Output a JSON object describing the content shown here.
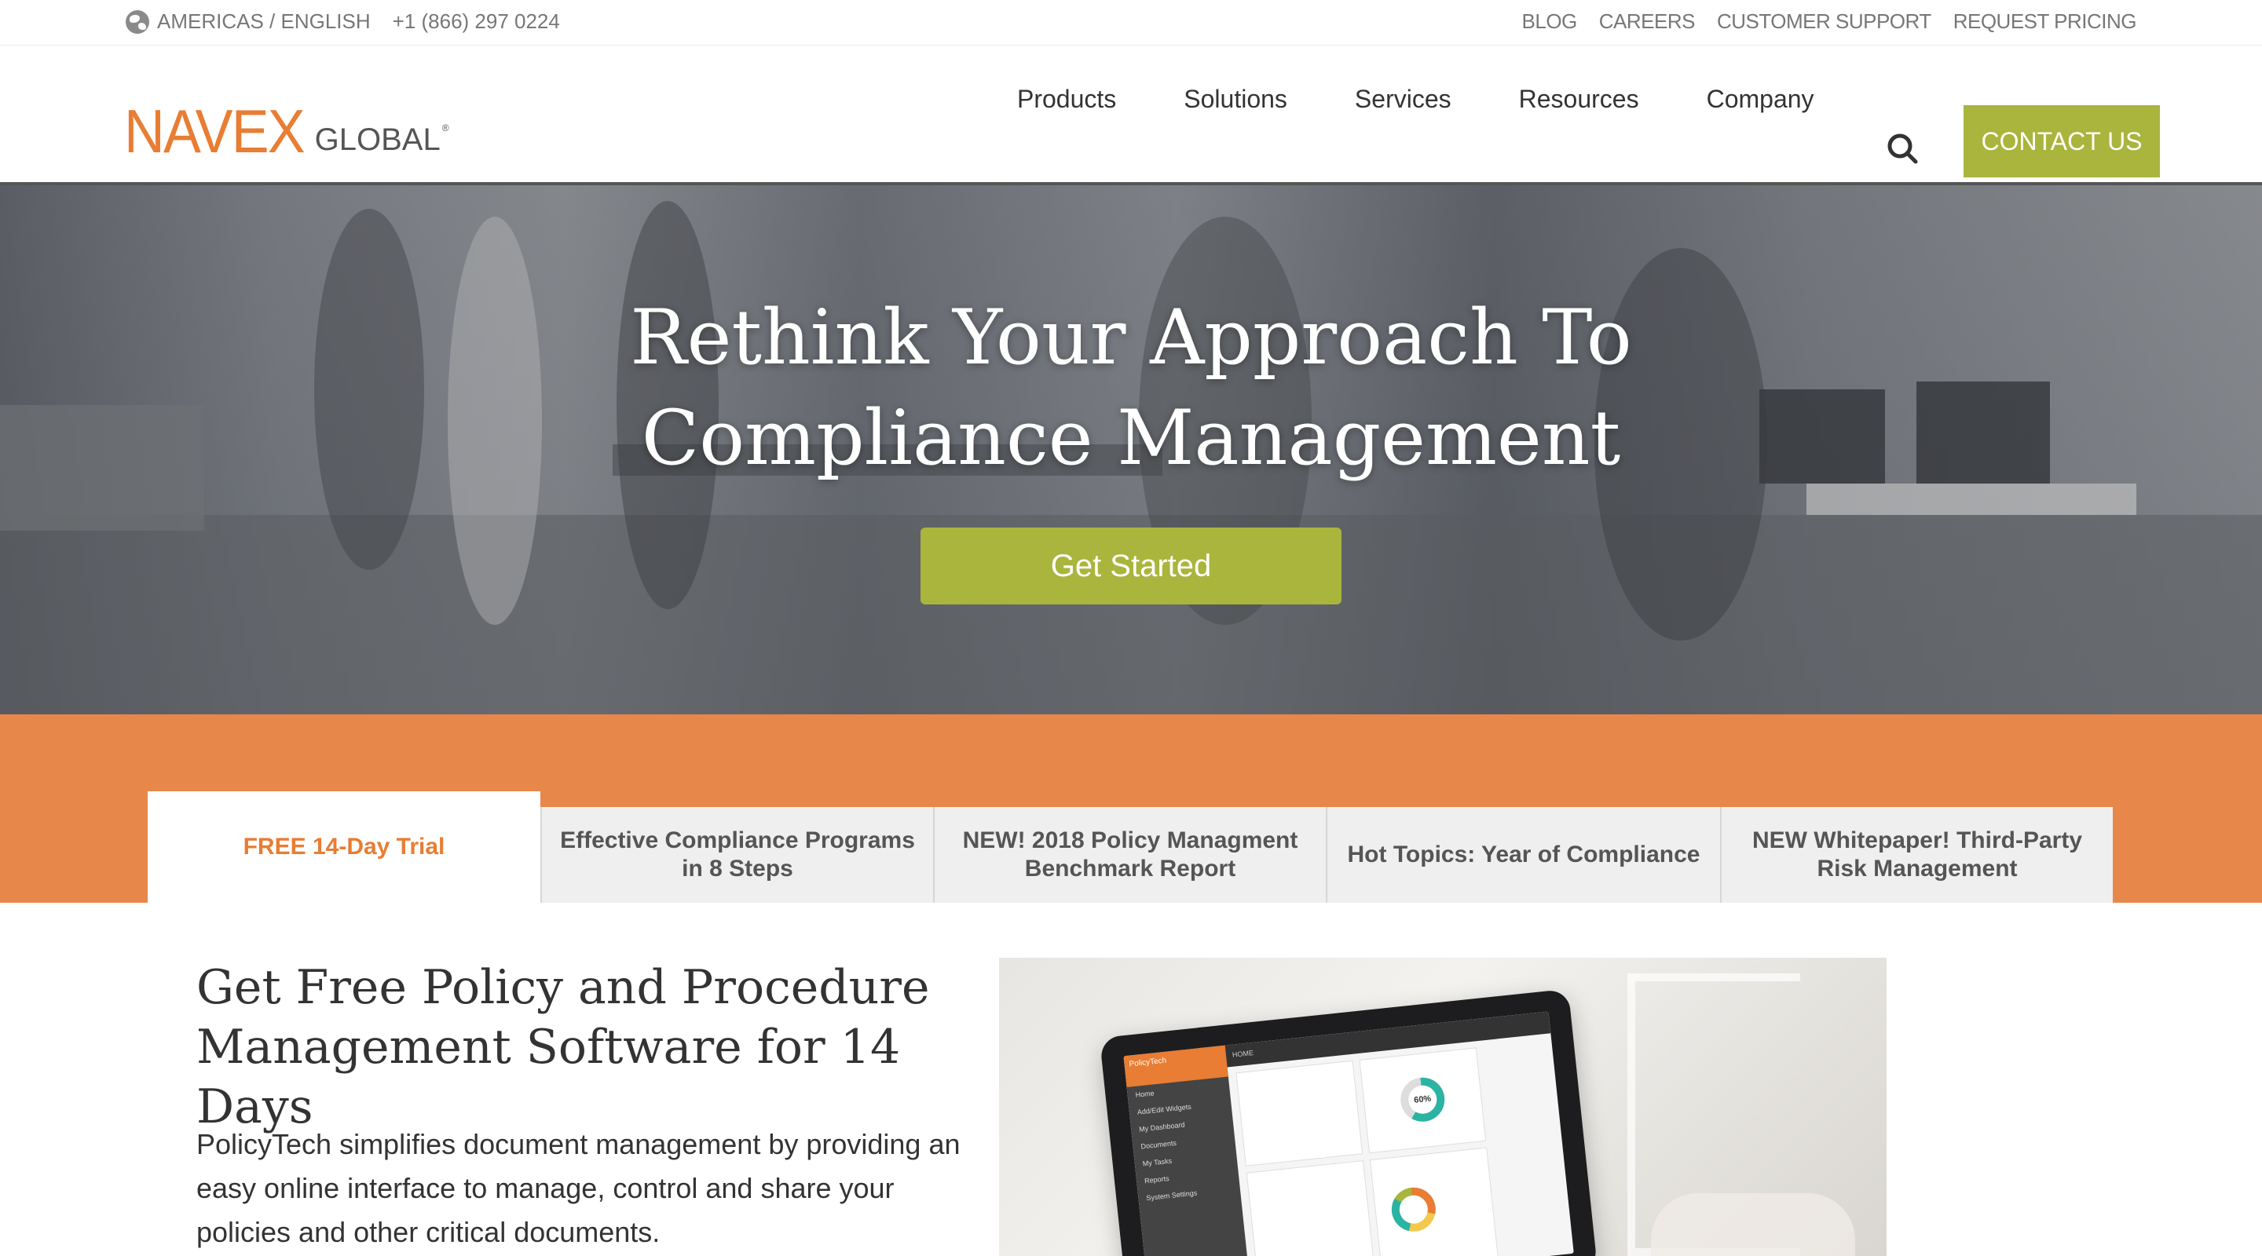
{
  "utility": {
    "region": "AMERICAS / ENGLISH",
    "phone": "+1 (866) 297 0224",
    "links": [
      "BLOG",
      "CAREERS",
      "CUSTOMER SUPPORT",
      "REQUEST PRICING"
    ]
  },
  "header": {
    "logo_main": "NAVEX",
    "logo_sub": "GLOBAL",
    "logo_reg": "®",
    "nav": [
      "Products",
      "Solutions",
      "Services",
      "Resources",
      "Company"
    ],
    "contact_label": "CONTACT US"
  },
  "hero": {
    "title_line1": "Rethink Your Approach To",
    "title_line2": "Compliance Management",
    "cta_label": "Get Started"
  },
  "tabs": [
    {
      "line1": "FREE 14-Day Trial",
      "line2": ""
    },
    {
      "line1": "Effective Compliance Programs",
      "line2": "in 8 Steps"
    },
    {
      "line1": "NEW! 2018 Policy Managment",
      "line2": "Benchmark Report"
    },
    {
      "line1": "Hot Topics: Year of Compliance",
      "line2": ""
    },
    {
      "line1": "NEW Whitepaper! Third-Party",
      "line2": "Risk Management"
    }
  ],
  "content": {
    "title_line1": "Get Free Policy and Procedure",
    "title_line2": "Management Software for 14 Days",
    "body_line1": "PolicyTech simplifies document management by providing an",
    "body_line2": "easy online interface to manage, control and share your",
    "body_line3": "policies and other critical documents."
  },
  "product_screen": {
    "app_title": "PolicyTech",
    "menu": [
      "Home",
      "Add/Edit Widgets",
      "My Dashboard",
      "Documents",
      "My Tasks",
      "Reports",
      "System Settings"
    ],
    "topbar": "HOME",
    "donut_label": "60%"
  },
  "colors": {
    "brand_orange": "#e87d33",
    "accent_green": "#a9b53c",
    "tab_bg": "#efefef"
  }
}
